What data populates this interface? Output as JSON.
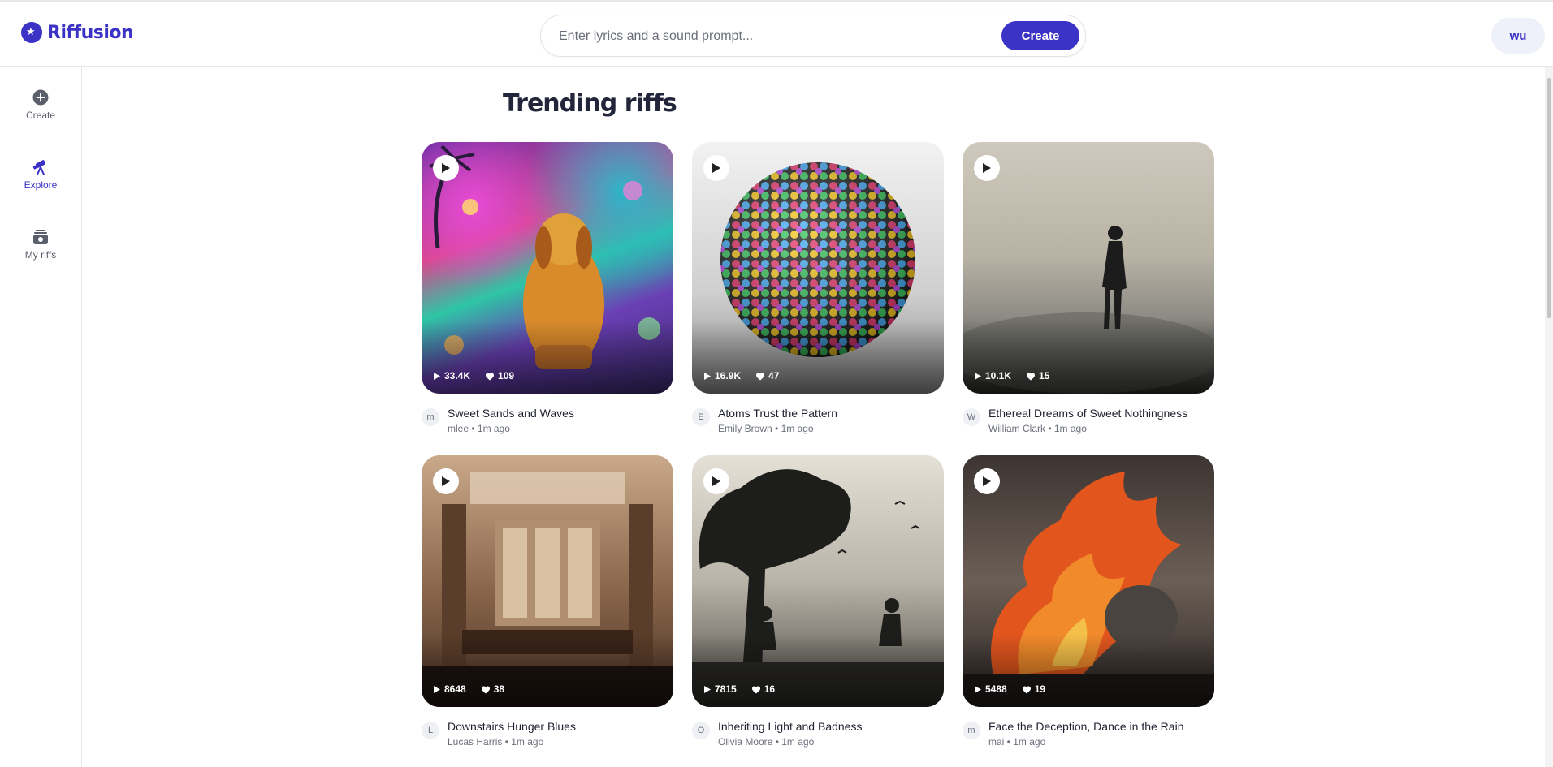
{
  "brand": {
    "name": "Riffusion"
  },
  "search": {
    "placeholder": "Enter lyrics and a sound prompt...",
    "value": "",
    "create_label": "Create"
  },
  "user": {
    "initials": "wu"
  },
  "sidebar": {
    "items": [
      {
        "label": "Create",
        "icon": "plus-circle-icon",
        "active": false
      },
      {
        "label": "Explore",
        "icon": "telescope-icon",
        "active": true
      },
      {
        "label": "My riffs",
        "icon": "library-icon",
        "active": false
      }
    ]
  },
  "main": {
    "title": "Trending riffs",
    "riffs": [
      {
        "title": "Sweet Sands and Waves",
        "author": "mlee",
        "initial": "m",
        "time": "1m ago",
        "plays": "33.4K",
        "likes": "109",
        "art": "neon-dog-beach"
      },
      {
        "title": "Atoms Trust the Pattern",
        "author": "Emily Brown",
        "initial": "E",
        "time": "1m ago",
        "plays": "16.9K",
        "likes": "47",
        "art": "mosaic-sphere"
      },
      {
        "title": "Ethereal Dreams of Sweet Nothingness",
        "author": "William Clark",
        "initial": "W",
        "time": "1m ago",
        "plays": "10.1K",
        "likes": "15",
        "art": "figure-in-fog"
      },
      {
        "title": "Downstairs Hunger Blues",
        "author": "Lucas Harris",
        "initial": "L",
        "time": "1m ago",
        "plays": "8648",
        "likes": "38",
        "art": "grand-dining-hall"
      },
      {
        "title": "Inheriting Light and Badness",
        "author": "Olivia Moore",
        "initial": "O",
        "time": "1m ago",
        "plays": "7815",
        "likes": "16",
        "art": "guitarists-under-tree"
      },
      {
        "title": "Face the Deception, Dance in the Rain",
        "author": "mai",
        "initial": "m",
        "time": "1m ago",
        "plays": "5488",
        "likes": "19",
        "art": "figure-and-fire"
      }
    ]
  },
  "colors": {
    "accent": "#3b32c6",
    "text": "#1f2230",
    "muted": "#6b6f7a",
    "border": "#e6e7eb"
  }
}
